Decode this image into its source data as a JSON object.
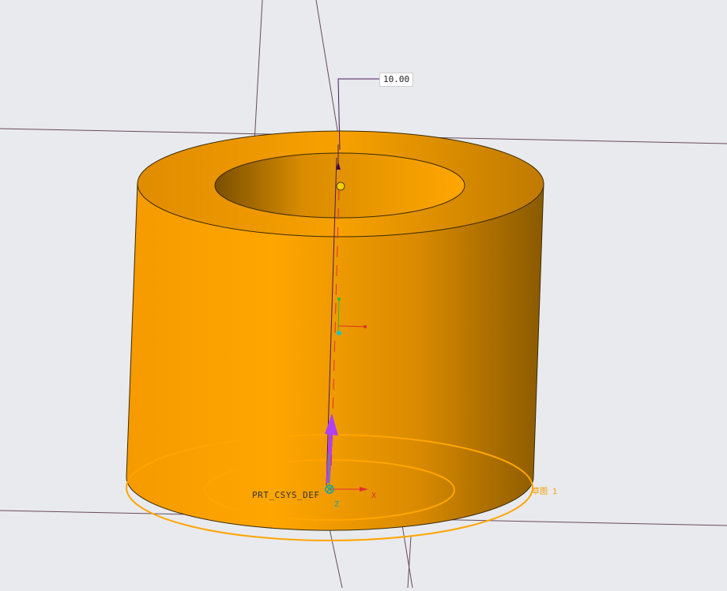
{
  "model": {
    "dimension_value": "10.00",
    "csys_label": "PRT_CSYS_DEF",
    "axis_x_label": "X",
    "axis_z_label": "Z",
    "sketch_plane_label": "草图 1"
  },
  "colors": {
    "background": "#e8eaee",
    "solid_body": "#f5a000",
    "solid_shadow": "#8a5a00",
    "datum_line": "#6a4b5a",
    "sketch_highlight": "#ffa500",
    "axis_x": "#e03030",
    "axis_y": "#23c23a",
    "axis_z": "#18a4a4",
    "drag_arrow": "#b040f0"
  }
}
